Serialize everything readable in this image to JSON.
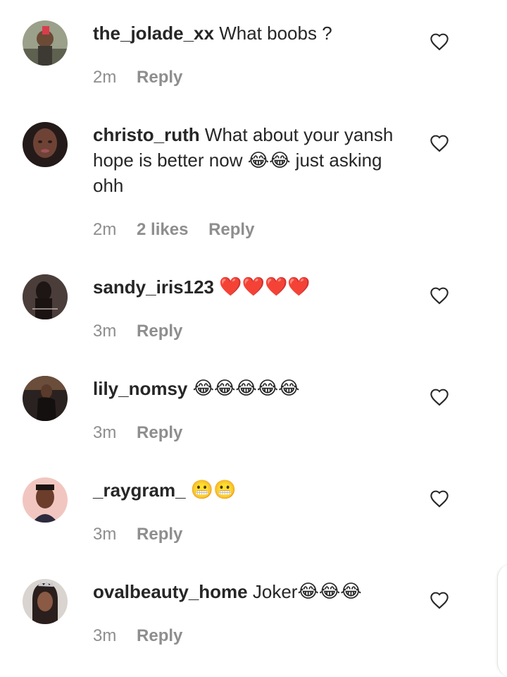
{
  "comments": [
    {
      "username": "the_jolade_xx",
      "text": "What boobs ?",
      "emoji": "",
      "time": "2m",
      "likes": "",
      "reply": "Reply"
    },
    {
      "username": "christo_ruth",
      "text": "What about your yansh hope is better now 😂😂 just asking ohh",
      "emoji": "",
      "time": "2m",
      "likes": "2 likes",
      "reply": "Reply"
    },
    {
      "username": "sandy_iris123",
      "text": "",
      "emoji": "❤️❤️❤️❤️",
      "time": "3m",
      "likes": "",
      "reply": "Reply"
    },
    {
      "username": "lily_nomsy",
      "text": "",
      "emoji": "😂😂😂😂😂",
      "time": "3m",
      "likes": "",
      "reply": "Reply"
    },
    {
      "username": "_raygram_",
      "text": "",
      "emoji": "😬😬",
      "time": "3m",
      "likes": "",
      "reply": "Reply"
    },
    {
      "username": "ovalbeauty_home",
      "text": "Joker",
      "emoji": "😂😂😂",
      "time": "3m",
      "likes": "",
      "reply": "Reply"
    }
  ],
  "icons": {
    "like": "heart-outline-icon"
  },
  "colors": {
    "text": "#262626",
    "meta": "#8e8e8e"
  }
}
